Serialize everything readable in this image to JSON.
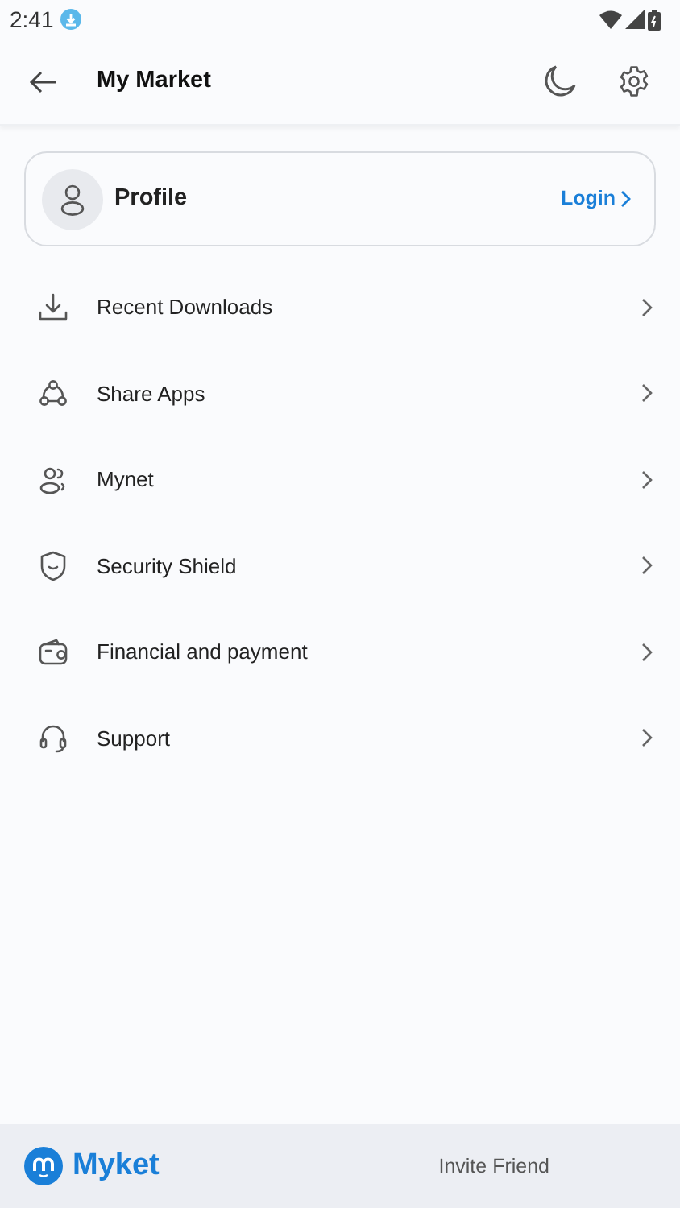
{
  "status_bar": {
    "time": "2:41"
  },
  "header": {
    "title": "My Market"
  },
  "profile": {
    "name": "Profile",
    "login": "Login"
  },
  "menu": [
    {
      "label": "Recent Downloads"
    },
    {
      "label": "Share Apps"
    },
    {
      "label": "Mynet"
    },
    {
      "label": "Security Shield"
    },
    {
      "label": "Financial and payment"
    },
    {
      "label": "Support"
    }
  ],
  "footer": {
    "brand": "Myket",
    "invite": "Invite Friend"
  }
}
